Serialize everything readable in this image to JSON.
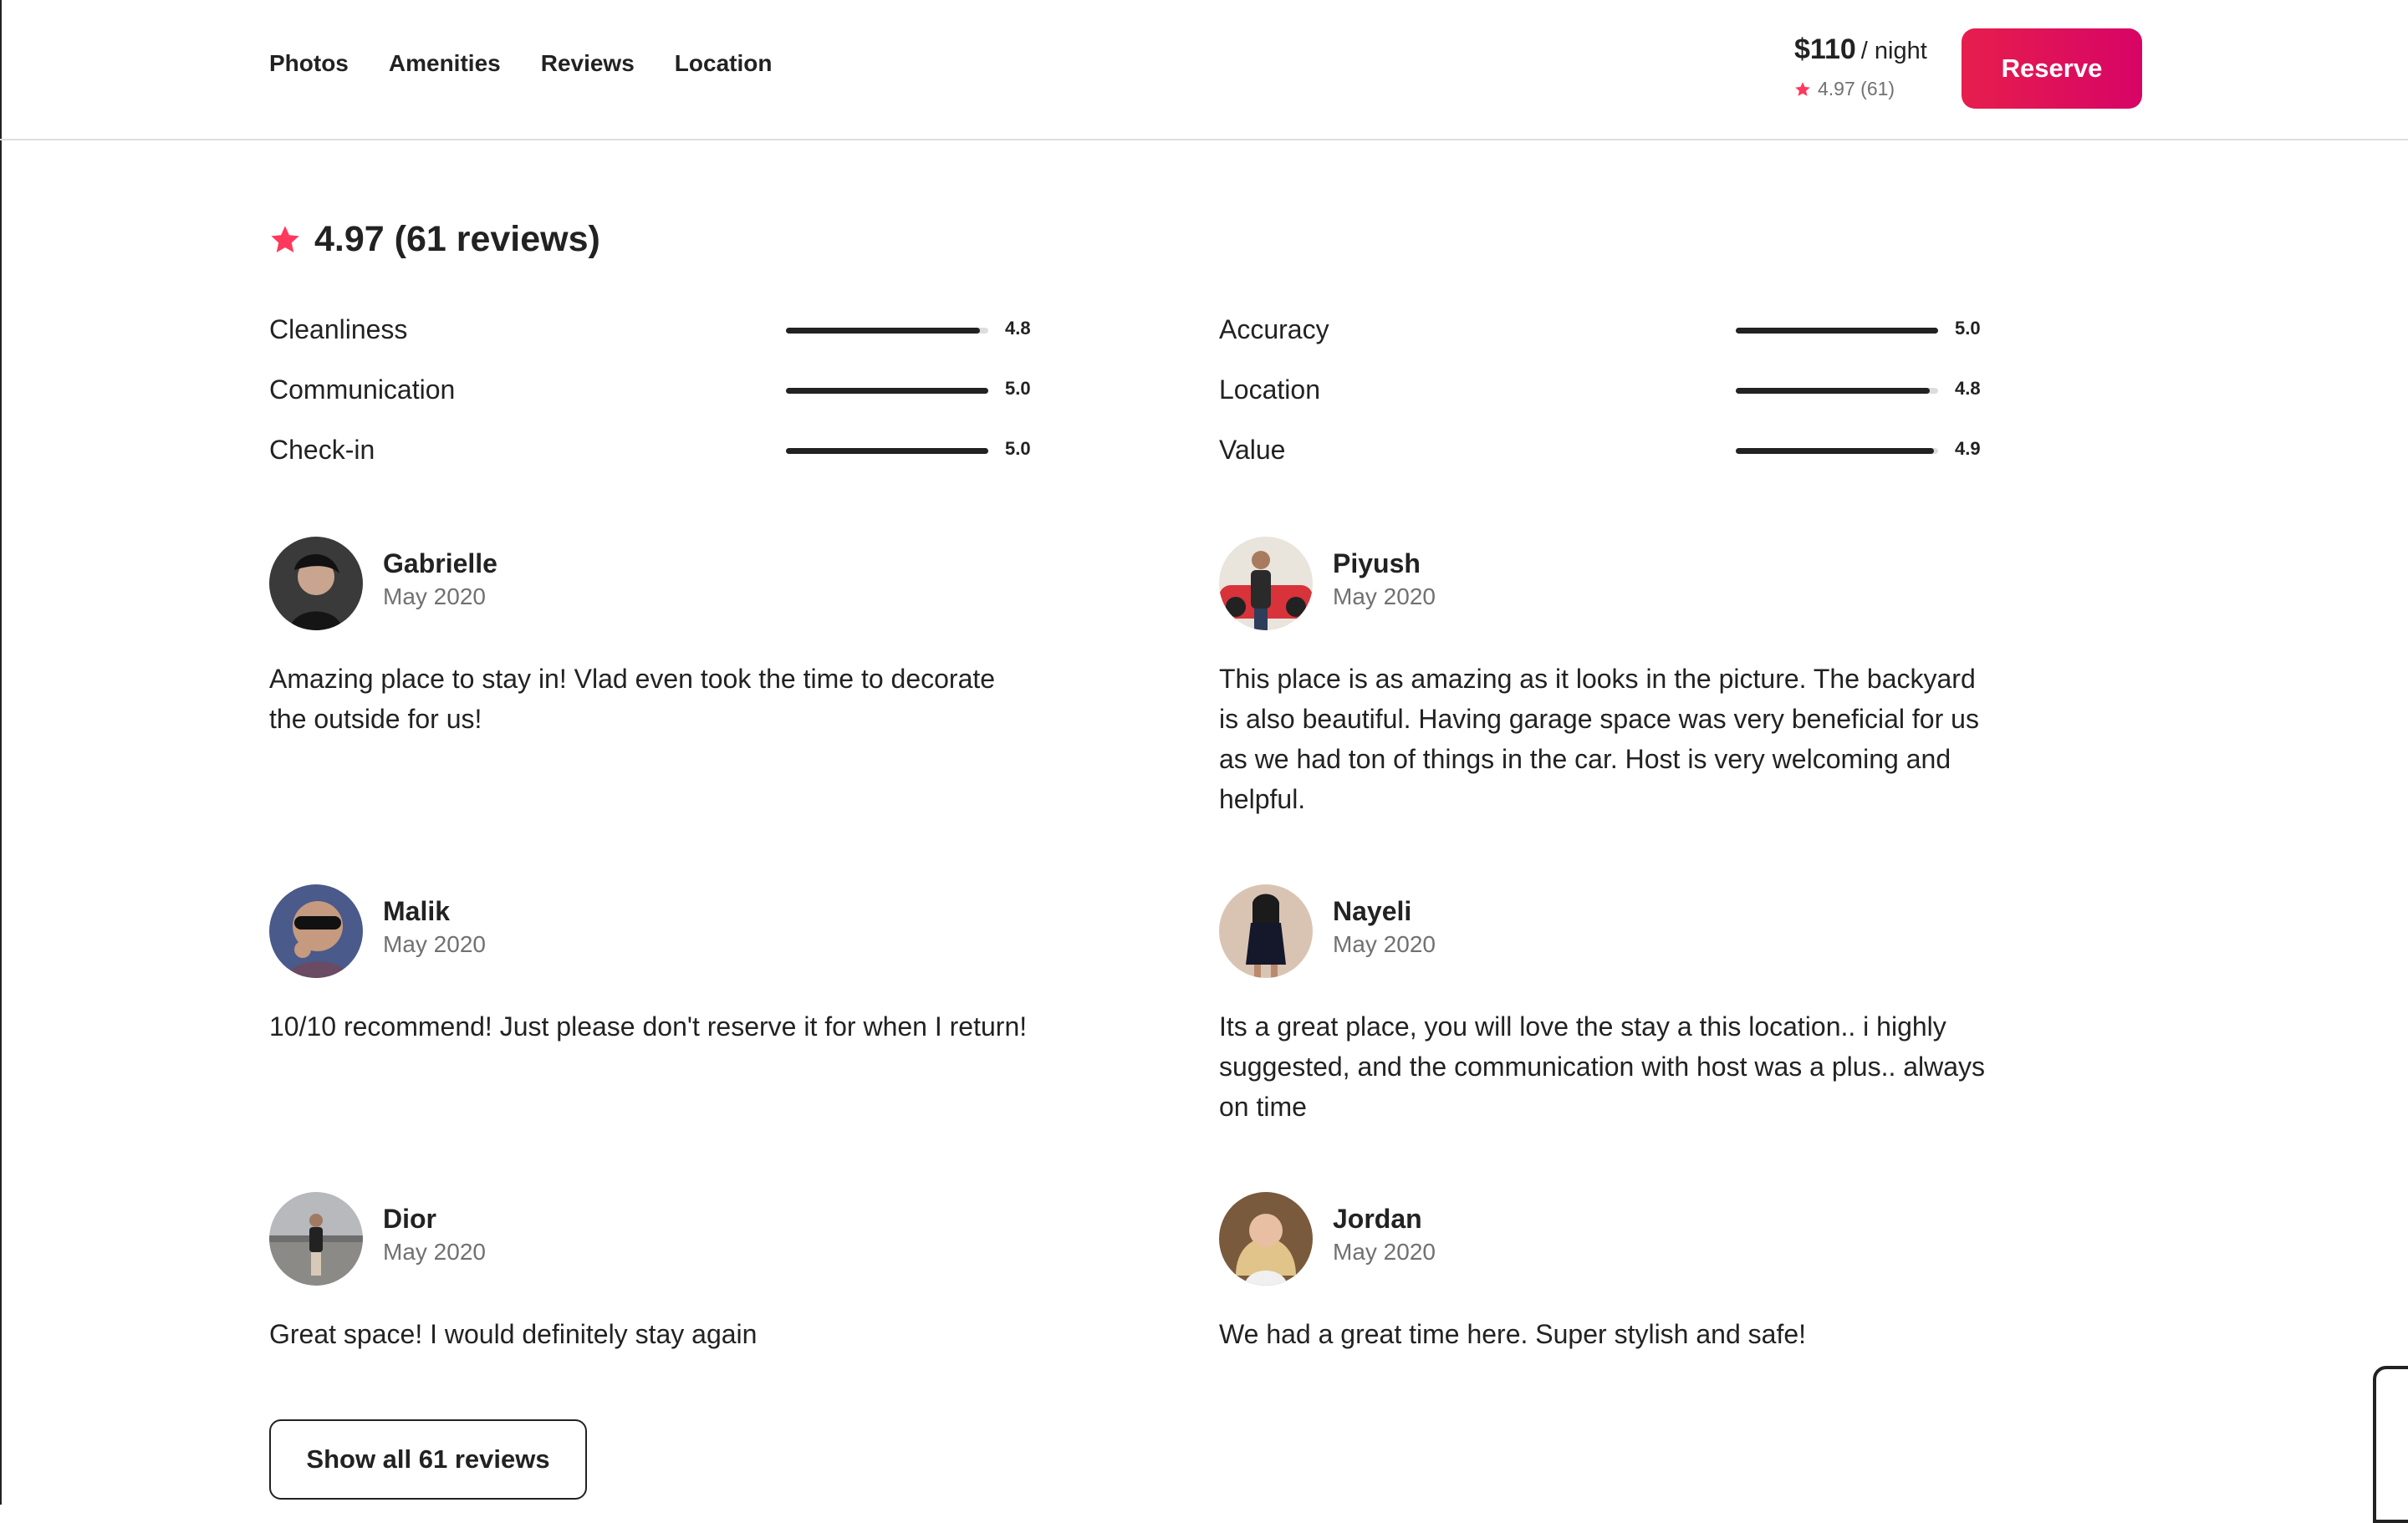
{
  "nav": {
    "items": [
      {
        "label": "Photos"
      },
      {
        "label": "Amenities"
      },
      {
        "label": "Reviews"
      },
      {
        "label": "Location"
      }
    ]
  },
  "booking": {
    "price": "$110",
    "per_night": "/ night",
    "mini_rating": "4.97 (61)",
    "reserve_label": "Reserve"
  },
  "reviews_summary": {
    "text": "4.97 (61 reviews)",
    "accent_color": "#FF385C"
  },
  "category_ratings": [
    {
      "label": "Cleanliness",
      "score": "4.8",
      "value": 4.8
    },
    {
      "label": "Accuracy",
      "score": "5.0",
      "value": 5.0
    },
    {
      "label": "Communication",
      "score": "5.0",
      "value": 5.0
    },
    {
      "label": "Location",
      "score": "4.8",
      "value": 4.8
    },
    {
      "label": "Check-in",
      "score": "5.0",
      "value": 5.0
    },
    {
      "label": "Value",
      "score": "4.9",
      "value": 4.9
    }
  ],
  "reviews": [
    {
      "name": "Gabrielle",
      "date": "May 2020",
      "text": "Amazing place to stay in! Vlad even took the time to decorate the outside for us!"
    },
    {
      "name": "Piyush",
      "date": "May 2020",
      "text": "This place is as amazing as it looks in the picture. The backyard is also beautiful. Having garage space was very beneficial for us as we had ton of things in the car. Host is very welcoming and helpful."
    },
    {
      "name": "Malik",
      "date": "May 2020",
      "text": "10/10 recommend! Just please don't reserve it for when I return!"
    },
    {
      "name": "Nayeli",
      "date": "May 2020",
      "text": "Its a great place, you will love the stay a this location.. i highly suggested, and the communication with host was a plus.. always on time"
    },
    {
      "name": "Dior",
      "date": "May 2020",
      "text": "Great space! I would definitely stay again"
    },
    {
      "name": "Jordan",
      "date": "May 2020",
      "text": "We had a great time here. Super stylish and safe!"
    }
  ],
  "show_all_label": "Show all 61 reviews"
}
